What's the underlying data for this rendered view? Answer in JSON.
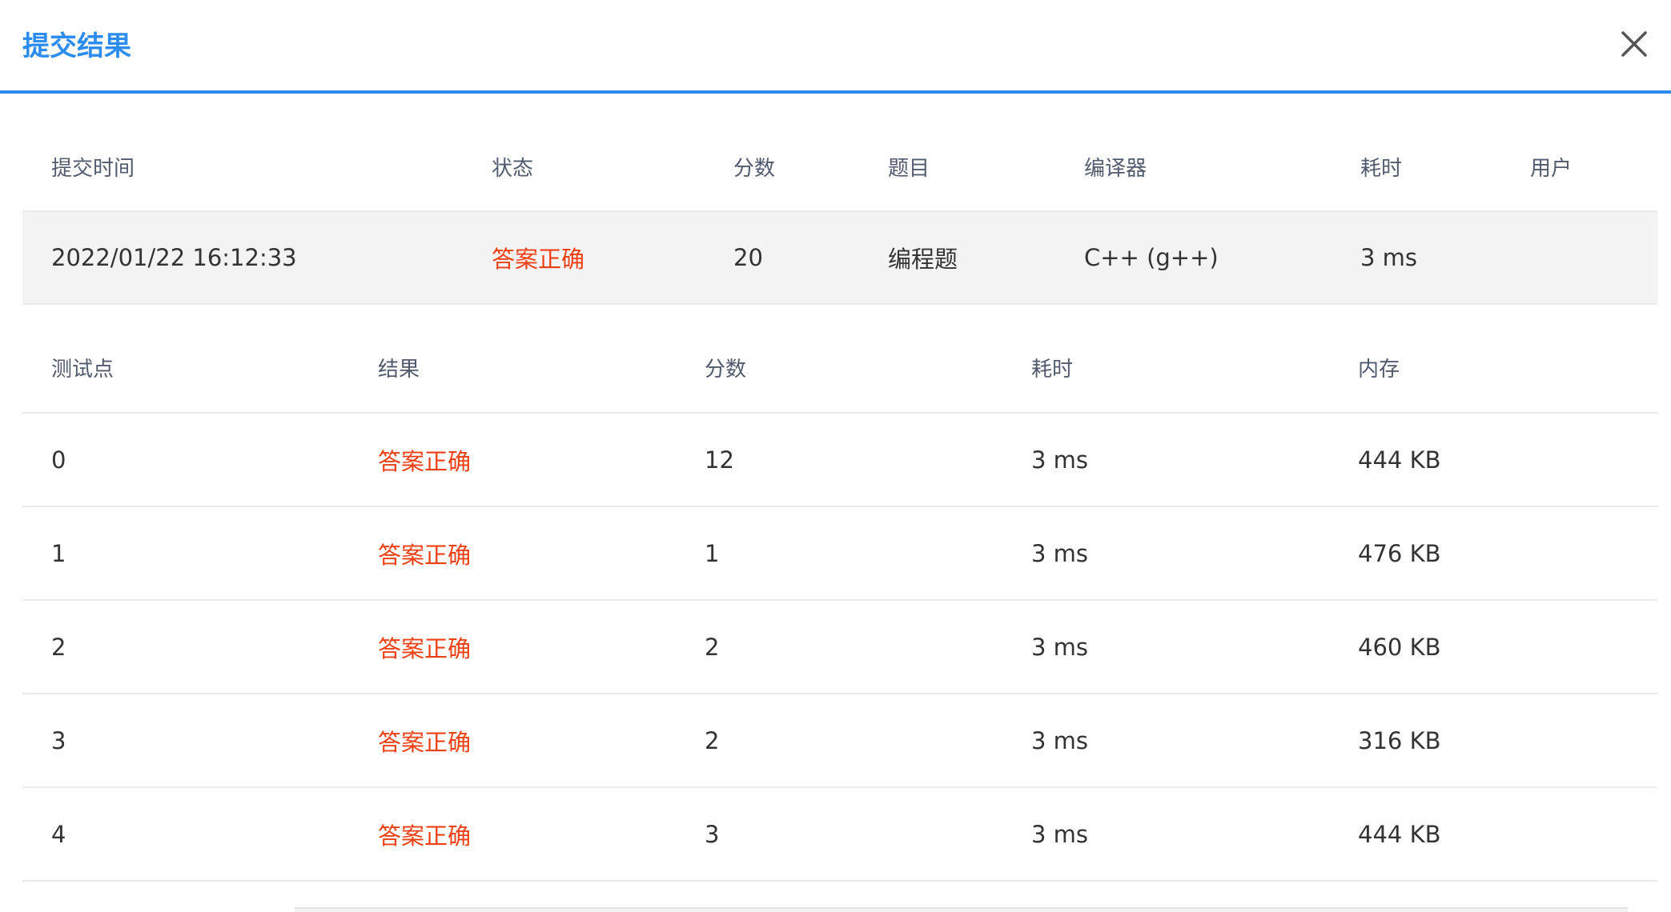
{
  "dialog": {
    "title": "提交结果",
    "close_icon": "close-icon"
  },
  "summary": {
    "headers": [
      "提交时间",
      "状态",
      "分数",
      "题目",
      "编译器",
      "耗时",
      "用户"
    ],
    "row": {
      "time": "2022/01/22 16:12:33",
      "status": "答案正确",
      "score": "20",
      "problem": "编程题",
      "compiler": "C++ (g++)",
      "elapsed": "3 ms",
      "user": ""
    }
  },
  "tests": {
    "headers": [
      "测试点",
      "结果",
      "分数",
      "耗时",
      "内存"
    ],
    "rows": [
      {
        "case": "0",
        "result": "答案正确",
        "score": "12",
        "time": "3 ms",
        "memory": "444 KB"
      },
      {
        "case": "1",
        "result": "答案正确",
        "score": "1",
        "time": "3 ms",
        "memory": "476 KB"
      },
      {
        "case": "2",
        "result": "答案正确",
        "score": "2",
        "time": "3 ms",
        "memory": "460 KB"
      },
      {
        "case": "3",
        "result": "答案正确",
        "score": "2",
        "time": "3 ms",
        "memory": "316 KB"
      },
      {
        "case": "4",
        "result": "答案正确",
        "score": "3",
        "time": "3 ms",
        "memory": "444 KB"
      }
    ]
  },
  "colors": {
    "accent": "#2d8cf0",
    "status_ok": "#ed3f14"
  }
}
